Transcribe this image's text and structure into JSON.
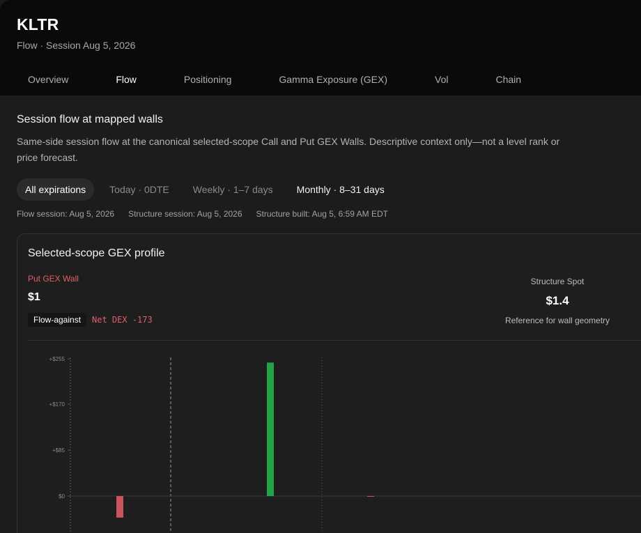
{
  "header": {
    "ticker": "KLTR",
    "subtitle": "Flow · Session Aug 5, 2026"
  },
  "tabs": [
    {
      "label": "Overview",
      "active": false
    },
    {
      "label": "Flow",
      "active": true
    },
    {
      "label": "Positioning",
      "active": false
    },
    {
      "label": "Gamma Exposure (GEX)",
      "active": false
    },
    {
      "label": "Vol",
      "active": false
    },
    {
      "label": "Chain",
      "active": false
    }
  ],
  "section": {
    "title": "Session flow at mapped walls",
    "description": "Same-side session flow at the canonical selected-scope Call and Put GEX Walls. Descriptive context only—not a level rank or price forecast."
  },
  "filters": [
    {
      "label": "All expirations",
      "selected": true
    },
    {
      "label": "Today · 0DTE",
      "selected": false
    },
    {
      "label": "Weekly · 1–7 days",
      "selected": false
    },
    {
      "label": "Monthly · 8–31 days",
      "selected": false
    }
  ],
  "meta": {
    "flow_session": "Flow session: Aug 5, 2026",
    "structure_session": "Structure session: Aug 5, 2026",
    "structure_built": "Structure built: Aug 5, 6:59 AM EDT"
  },
  "card": {
    "title": "Selected-scope GEX profile",
    "put_wall_label": "Put GEX Wall",
    "put_wall_value": "$1",
    "flow_badge": "Flow-against",
    "net_dex": "Net DEX -173",
    "spot_label": "Structure Spot",
    "spot_value": "$1.4",
    "spot_ref": "Reference for wall geometry"
  },
  "colors": {
    "positive": "#22a447",
    "negative": "#c9545c",
    "put_accent": "#e0606a"
  },
  "chart_data": {
    "type": "bar",
    "title": "",
    "xlabel": "",
    "ylabel": "",
    "y_ticks": [
      "+$255",
      "+$170",
      "+$85",
      "$0"
    ],
    "ylim": [
      -70,
      255
    ],
    "series": [
      {
        "values": [
          -40,
          248,
          -1
        ]
      }
    ],
    "reference_lines": [
      "dashed",
      "dotted"
    ],
    "grid": false
  }
}
